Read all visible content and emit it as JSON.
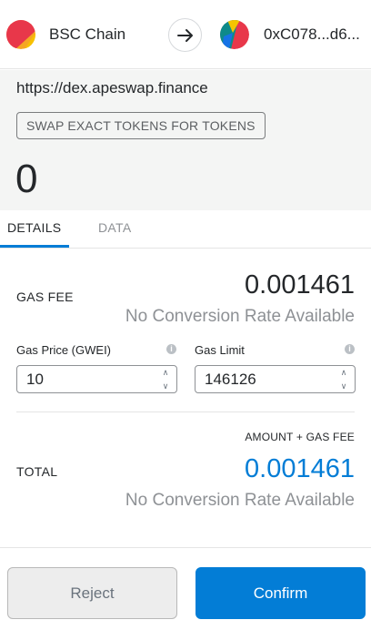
{
  "header": {
    "from_account": {
      "name": "BSC Chain",
      "avatar_icon": "jazzicon-avatar"
    },
    "arrow_icon": "arrow-right-icon",
    "to_account": {
      "name": "0xC078...d6...",
      "avatar_icon": "jazzicon-avatar"
    }
  },
  "summary": {
    "origin": "https://dex.apeswap.finance",
    "method": "SWAP EXACT TOKENS FOR TOKENS",
    "amount": "0"
  },
  "tabs": [
    {
      "label": "DETAILS",
      "active": true
    },
    {
      "label": "DATA",
      "active": false
    }
  ],
  "details": {
    "gas_fee": {
      "label": "GAS FEE",
      "value": "0.001461",
      "conversion": "No Conversion Rate Available"
    },
    "gas_price": {
      "label": "Gas Price (GWEI)",
      "value": "10",
      "info_icon": "info-icon"
    },
    "gas_limit": {
      "label": "Gas Limit",
      "value": "146126",
      "info_icon": "info-icon"
    },
    "amount_plus_gas_label": "AMOUNT + GAS FEE",
    "total": {
      "label": "TOTAL",
      "value": "0.001461",
      "conversion": "No Conversion Rate Available"
    }
  },
  "footer": {
    "reject_label": "Reject",
    "confirm_label": "Confirm"
  },
  "colors": {
    "accent": "#037dd6",
    "muted_text": "#8e9195",
    "summary_bg": "#f4f5f4"
  }
}
